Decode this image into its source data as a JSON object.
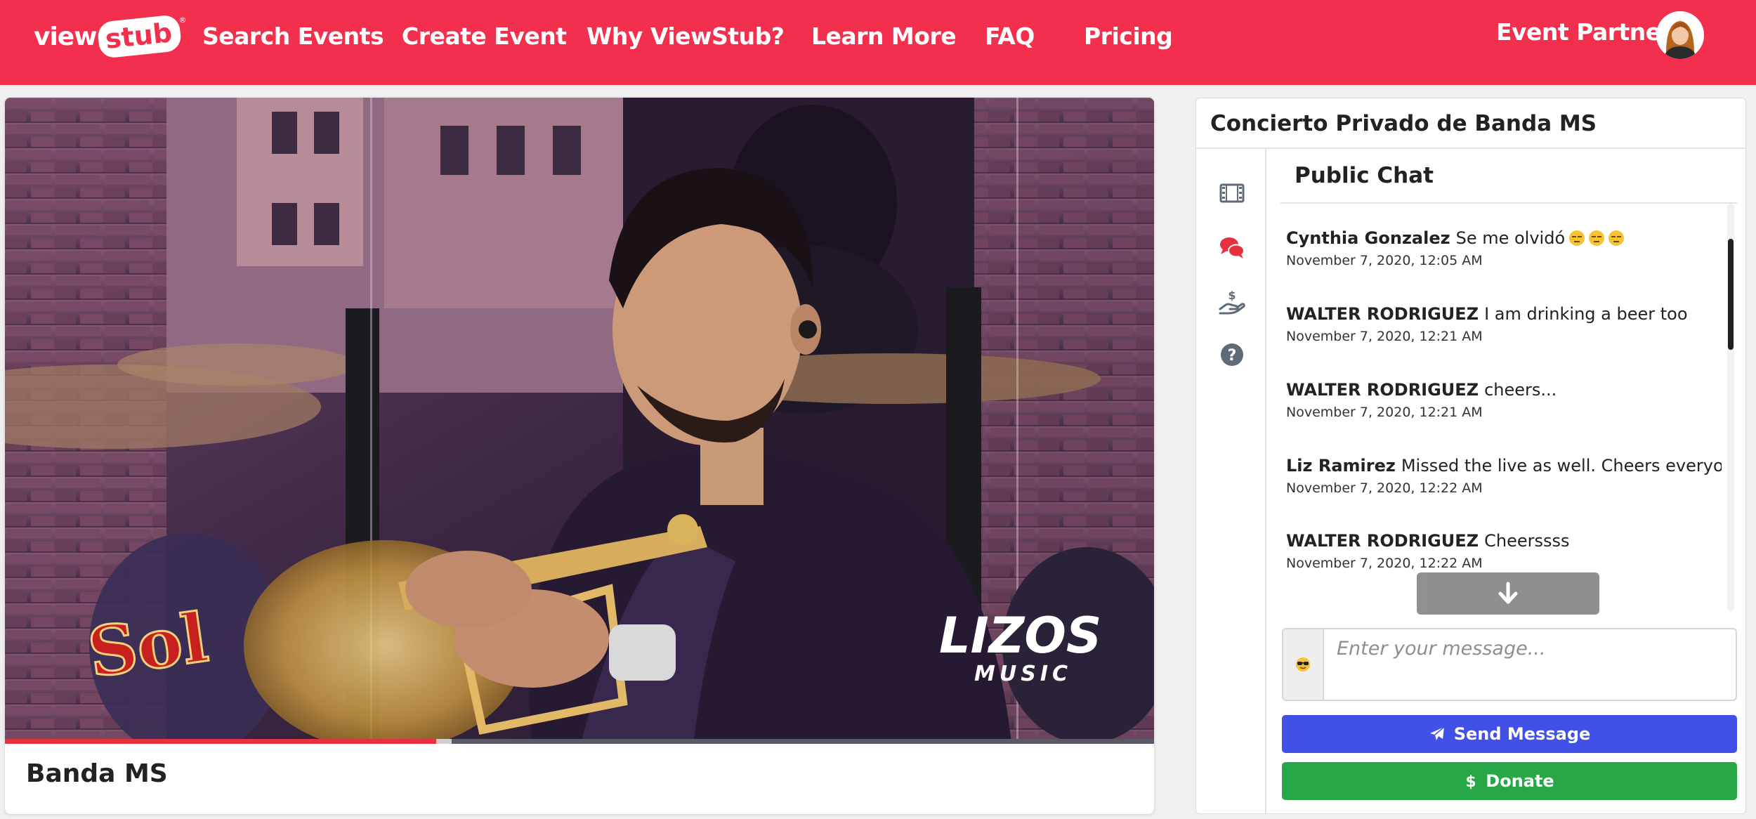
{
  "nav": {
    "logo_view": "view",
    "logo_stub": "stub",
    "logo_reg": "®",
    "links": [
      "Search Events",
      "Create Event",
      "Why ViewStub?",
      "Learn More",
      "FAQ",
      "Pricing"
    ],
    "partner_label": "Event Partner"
  },
  "video": {
    "title": "Banda MS",
    "progress_fraction": 0.375,
    "watermark_left": "Sol",
    "watermark_right_top": "LIZOS",
    "watermark_right_bottom": "MUSIC"
  },
  "panel": {
    "event_name": "Concierto Privado de Banda MS",
    "chat_title": "Public Chat",
    "messages": [
      {
        "author": "Cynthia Gonzalez",
        "text": "Se me olvidó",
        "emoji_count": 3,
        "time": "November 7, 2020, 12:05 AM"
      },
      {
        "author": "WALTER RODRIGUEZ",
        "text": "I am drinking a beer too",
        "emoji_count": 0,
        "time": "November 7, 2020, 12:21 AM"
      },
      {
        "author": "WALTER RODRIGUEZ",
        "text": "cheers...",
        "emoji_count": 0,
        "time": "November 7, 2020, 12:21 AM"
      },
      {
        "author": "Liz Ramirez",
        "text": "Missed the live as well. Cheers everyone!",
        "emoji_count": 0,
        "time": "November 7, 2020, 12:22 AM"
      },
      {
        "author": "WALTER RODRIGUEZ",
        "text": "Cheerssss",
        "emoji_count": 0,
        "time": "November 7, 2020, 12:22 AM"
      }
    ],
    "input_placeholder": "Enter your message...",
    "send_label": "Send Message",
    "donate_label": "Donate",
    "icons": [
      "film-icon",
      "comments-icon",
      "donate-hand-icon",
      "help-icon"
    ]
  },
  "colors": {
    "brand_red": "#f2304e",
    "send_blue": "#4151e8",
    "donate_green": "#27a745",
    "active_icon": "#e8313e",
    "inactive_icon": "#5f6b78"
  }
}
